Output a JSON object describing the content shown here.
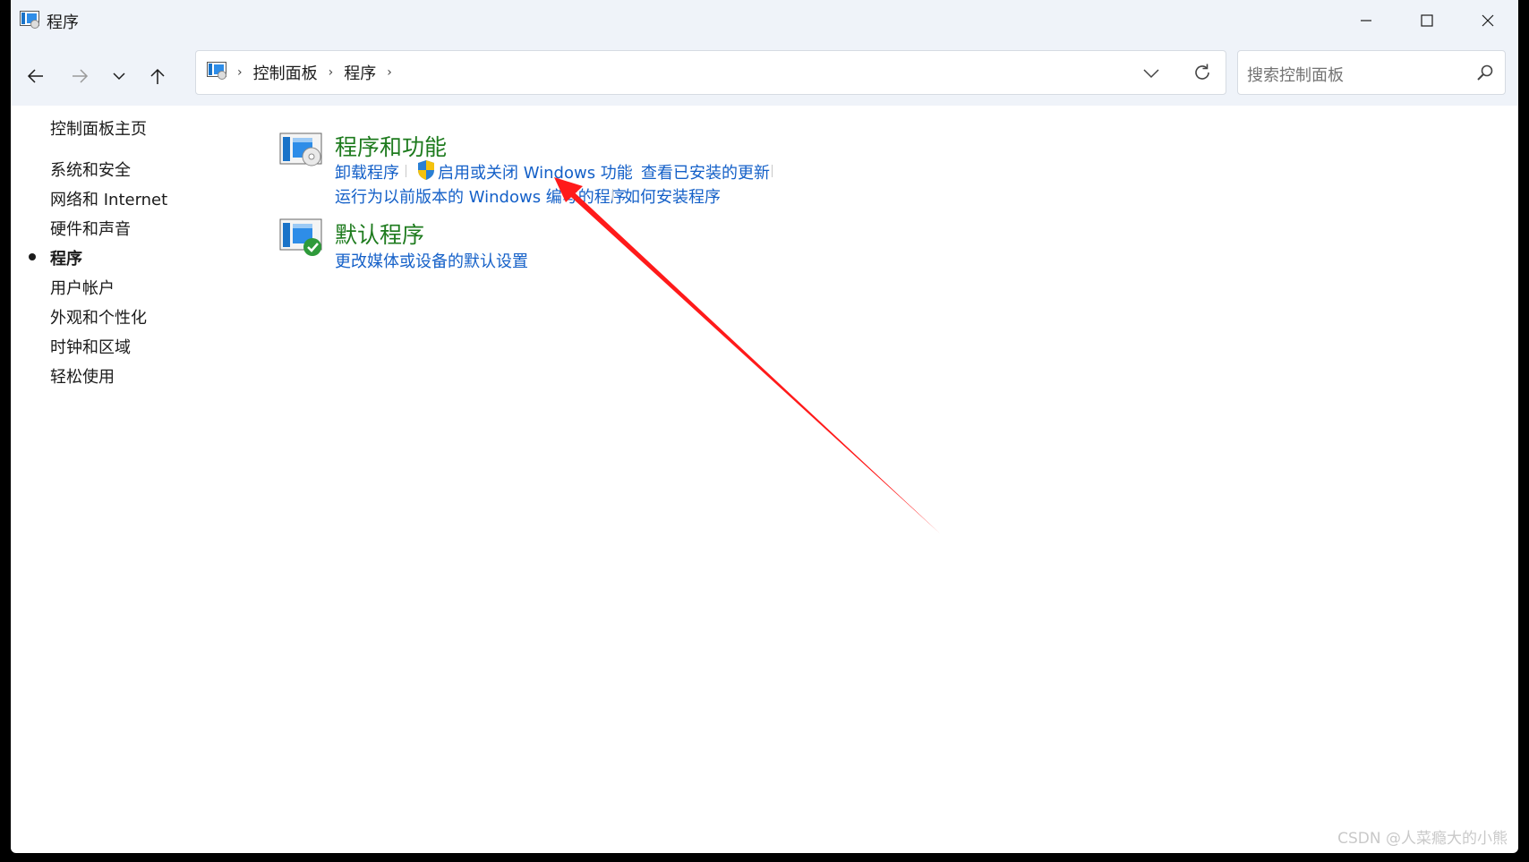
{
  "window": {
    "title": "程序"
  },
  "navigation": {
    "breadcrumb": [
      "控制面板",
      "程序"
    ],
    "search_placeholder": "搜索控制面板"
  },
  "sidebar": {
    "items": [
      {
        "label": "控制面板主页"
      },
      {
        "label": "系统和安全"
      },
      {
        "label": "网络和 Internet"
      },
      {
        "label": "硬件和声音"
      },
      {
        "label": "程序",
        "selected": true
      },
      {
        "label": "用户帐户"
      },
      {
        "label": "外观和个性化"
      },
      {
        "label": "时钟和区域"
      },
      {
        "label": "轻松使用"
      }
    ]
  },
  "categories": [
    {
      "title": "程序和功能",
      "links": [
        "卸载程序",
        "启用或关闭 Windows 功能",
        "查看已安装的更新",
        "运行为以前版本的 Windows 编写的程序",
        "如何安装程序"
      ]
    },
    {
      "title": "默认程序",
      "links": [
        "更改媒体或设备的默认设置"
      ]
    }
  ],
  "colors": {
    "heading": "#1e7b1e",
    "link": "#1460c8",
    "arrow": "#ff1a1a",
    "chrome": "#eff3f9"
  },
  "watermark": "CSDN @人菜瘾大的小熊"
}
